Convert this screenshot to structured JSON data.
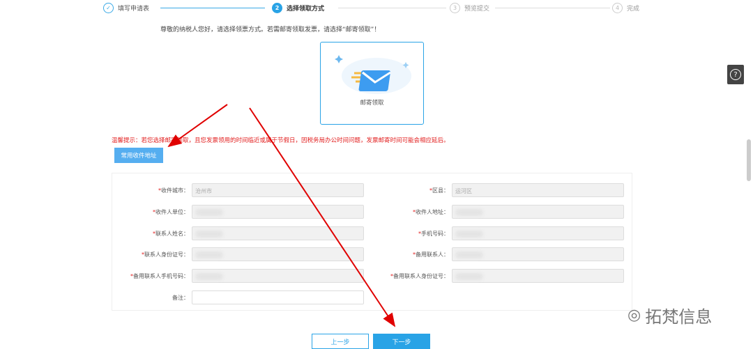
{
  "steps": [
    {
      "num": "✓",
      "label": "填写申请表",
      "state": "done"
    },
    {
      "num": "2",
      "label": "选择领取方式",
      "state": "active"
    },
    {
      "num": "3",
      "label": "预览提交",
      "state": "pending"
    },
    {
      "num": "4",
      "label": "完成",
      "state": "pending"
    }
  ],
  "intro": "尊敬的纳税人您好，请选择领票方式。若需邮寄领取发票，请选择“邮寄领取”！",
  "option": {
    "label": "邮寄领取",
    "icon": "envelope-icon"
  },
  "tip": "温馨提示：若您选择邮寄领取，且您发票领用的时间临近或属于节假日，因税务局办公时间问题，发票邮寄时间可能会相应延后。",
  "address_button": "常用收件地址",
  "form": {
    "city": {
      "label": "收件城市：",
      "value": "沧州市"
    },
    "district": {
      "label": "区县：",
      "value": "运河区"
    },
    "company": {
      "label": "收件人单位：",
      "value": ""
    },
    "address": {
      "label": "收件人地址：",
      "value": ""
    },
    "contact": {
      "label": "联系人姓名：",
      "value": ""
    },
    "phone": {
      "label": "手机号码：",
      "value": ""
    },
    "contact_id": {
      "label": "联系人身份证号：",
      "value": ""
    },
    "backup": {
      "label": "备用联系人：",
      "value": ""
    },
    "backup_phone": {
      "label": "备用联系人手机号码：",
      "value": ""
    },
    "backup_id": {
      "label": "备用联系人身份证号：",
      "value": ""
    },
    "remark": {
      "label": "备注：",
      "value": ""
    }
  },
  "buttons": {
    "prev": "上一步",
    "next": "下一步"
  },
  "help_icon": "?",
  "watermark": "拓梵信息",
  "colors": {
    "accent": "#29a3e6",
    "warning": "#e21d1d",
    "arrow": "#e00000"
  }
}
